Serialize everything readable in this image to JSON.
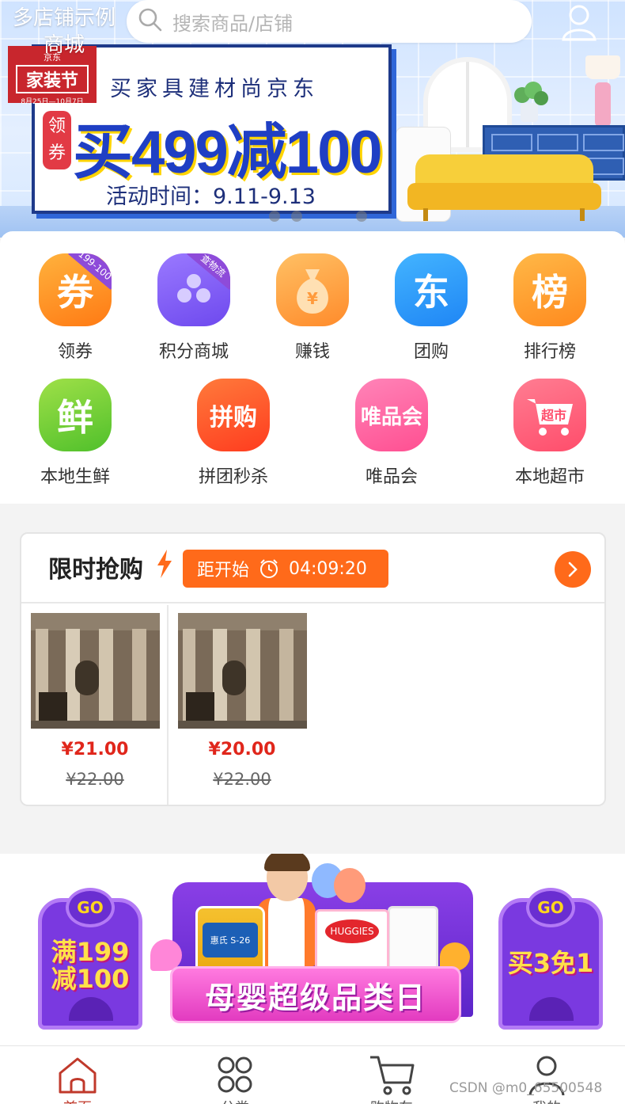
{
  "header": {
    "store_name": "多店铺示例商城",
    "search_placeholder": "搜索商品/店铺",
    "user_icon": "user-icon"
  },
  "banner": {
    "logo_top": "京东",
    "logo_main": "家装节",
    "logo_dates": "8月25日—10月7日",
    "headline": "买家具建材尚京东",
    "coupon_tag": "领券",
    "offer": "买499减100",
    "period": "活动时间：9.11-9.13",
    "slides": 3,
    "active_slide": 3
  },
  "categories": [
    {
      "label": "领券",
      "icon_text": "券",
      "badge": "199-100",
      "icon": "coupon-icon"
    },
    {
      "label": "积分商城",
      "icon_text": "",
      "badge": "查物流",
      "icon": "points-mall-icon"
    },
    {
      "label": "赚钱",
      "icon_text": "",
      "badge": "",
      "icon": "money-bag-icon"
    },
    {
      "label": "团购",
      "icon_text": "东",
      "badge": "",
      "icon": "group-buy-icon"
    },
    {
      "label": "排行榜",
      "icon_text": "榜",
      "badge": "",
      "icon": "ranking-icon"
    },
    {
      "label": "本地生鲜",
      "icon_text": "鲜",
      "badge": "",
      "icon": "fresh-icon"
    },
    {
      "label": "拼团秒杀",
      "icon_text": "拼购",
      "badge": "",
      "icon": "group-flash-icon"
    },
    {
      "label": "唯品会",
      "icon_text": "唯品会",
      "badge": "",
      "icon": "vip-icon"
    },
    {
      "label": "本地超市",
      "icon_text": "超市",
      "badge": "",
      "icon": "supermarket-icon"
    }
  ],
  "flash_sale": {
    "title": "限时抢购",
    "countdown_label": "距开始",
    "countdown_time": "04:09:20",
    "products": [
      {
        "price": "¥21.00",
        "original_price": "¥22.00"
      },
      {
        "price": "¥20.00",
        "original_price": "¥22.00"
      }
    ]
  },
  "promo_banner": {
    "left_go": "GO",
    "left_offer": "满199减100",
    "right_go": "GO",
    "right_offer": "买3免1",
    "title": "母婴超级品类日",
    "can_label": "惠氏 S-26",
    "diaper_label": "HUGGIES"
  },
  "tabbar": {
    "items": [
      {
        "label": "首页",
        "icon": "home-icon",
        "active": true
      },
      {
        "label": "分类",
        "icon": "category-icon",
        "active": false
      },
      {
        "label": "购物车",
        "icon": "cart-icon",
        "active": false
      },
      {
        "label": "我的",
        "icon": "profile-icon",
        "active": false
      }
    ]
  },
  "watermark": "CSDN @m0_65500548",
  "colors": {
    "accent": "#ff6a1a",
    "price_red": "#e0261b",
    "active_tab": "#c0392b"
  }
}
